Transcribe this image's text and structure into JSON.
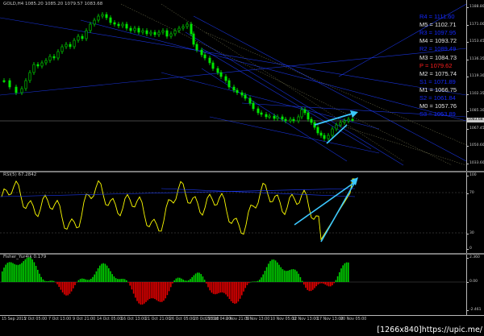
{
  "price_panel": {
    "header": "GOLD,H4  1085.20 1085.20 1079.57 1083.68",
    "price_ticks": [
      "1188.80",
      "1171.00",
      "1153.45",
      "1136.35",
      "1119.30",
      "1102.35",
      "1085.30",
      "1067.45",
      "1050.60",
      "1033.60"
    ],
    "pivots": [
      {
        "label": "R4 = 1111.60",
        "color": "#1428ff"
      },
      {
        "label": "M5 = 1102.71",
        "color": "#e6e6e6"
      },
      {
        "label": "R3 = 1097.95",
        "color": "#1428ff"
      },
      {
        "label": "M4 = 1093.72",
        "color": "#e6e6e6"
      },
      {
        "label": "R2 = 1089.49",
        "color": "#1428ff"
      },
      {
        "label": "M3 = 1084.73",
        "color": "#e6e6e6"
      },
      {
        "label": "P = 1079.62",
        "color": "#ff1e1e"
      },
      {
        "label": "M2 = 1075.74",
        "color": "#e6e6e6"
      },
      {
        "label": "S1 = 1071.89",
        "color": "#1428ff"
      },
      {
        "label": "M1 = 1066.75",
        "color": "#e6e6e6"
      },
      {
        "label": "S2 = 1061.84",
        "color": "#1428ff"
      },
      {
        "label": "M0 = 1057.76",
        "color": "#e6e6e6"
      },
      {
        "label": "S3 = 1053.89",
        "color": "#1428ff"
      }
    ],
    "current_price_tag": "1083.68"
  },
  "rsi_panel": {
    "header": "RSI(5) 67.2842",
    "ticks": [
      "100",
      "70",
      "30",
      "0"
    ]
  },
  "fisher_panel": {
    "header": "Fisher_Yur4ik 0.179",
    "ticks": [
      "2.360",
      "0.00",
      "-2.461"
    ]
  },
  "date_axis": [
    "15 Sep 2015",
    "2 Oct 05:00",
    "7 Oct 13:00",
    "9 Oct 21:00",
    "14 Oct 05:00",
    "16 Oct 13:00",
    "21 Oct 21:00",
    "26 Oct 05:00",
    "28 Oct 13:00",
    "29 Oct 04:00",
    "2 Nov 21:00",
    "5 Nov 13:00",
    "10 Nov 05:00",
    "12 Nov 13:00",
    "17 Nov 13:00",
    "20 Nov 05:00"
  ],
  "watermark": "[1266x840]https://upic.me/",
  "colors": {
    "candle": "#00e600",
    "rsi": "#ffff00",
    "arrow": "#3cc8ff",
    "fisher_up": "#00d200",
    "fisher_down": "#e60000",
    "trendline": "#1e3cff",
    "grid": "#3a3a3a"
  }
}
